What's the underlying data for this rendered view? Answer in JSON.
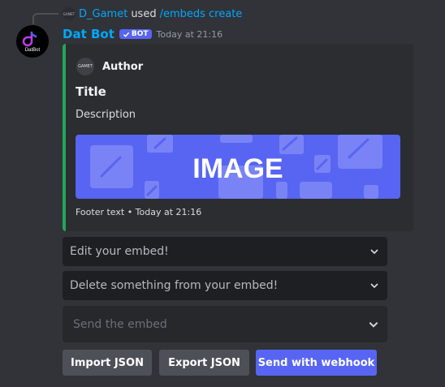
{
  "reply": {
    "avatar_text": "GAMET",
    "user": "D_Gamet",
    "used_text": "used",
    "command": "/embeds create"
  },
  "message": {
    "avatar_text": "DatBot",
    "author": "Dat Bot",
    "bot_tag": "BOT",
    "timestamp": "Today at 21:16"
  },
  "embed": {
    "accent_color": "#23a55a",
    "author_icon_text": "GAMET",
    "author": "Author",
    "title": "Title",
    "description": "Description",
    "image_text": "IMAGE",
    "image_color": "#5865f2",
    "footer": "Footer text • Today at 21:16"
  },
  "selects": [
    {
      "placeholder": "Edit your embed!",
      "disabled": false
    },
    {
      "placeholder": "Delete something from your embed!",
      "disabled": false
    },
    {
      "placeholder": "Send the embed",
      "disabled": true
    }
  ],
  "buttons": [
    {
      "label": "Import JSON",
      "style": "secondary"
    },
    {
      "label": "Export JSON",
      "style": "secondary"
    },
    {
      "label": "Send with webhook",
      "style": "primary"
    }
  ]
}
